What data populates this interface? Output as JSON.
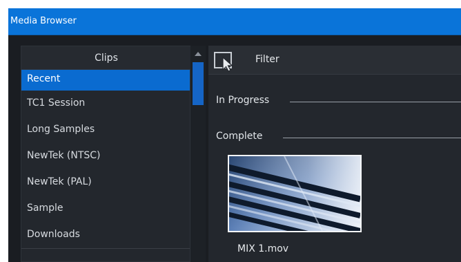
{
  "window": {
    "title": "Media Browser"
  },
  "clips_panel": {
    "header": "Clips",
    "items": [
      {
        "label": "Recent",
        "selected": true
      },
      {
        "label": "TC1 Session",
        "selected": false
      },
      {
        "label": "Long Samples",
        "selected": false
      },
      {
        "label": "NewTek (NTSC)",
        "selected": false
      },
      {
        "label": "NewTek (PAL)",
        "selected": false
      },
      {
        "label": "Sample",
        "selected": false
      },
      {
        "label": "Downloads",
        "selected": false
      }
    ]
  },
  "content_panel": {
    "filter_label": "Filter",
    "sections": {
      "in_progress": "In Progress",
      "complete": "Complete"
    },
    "media_items": [
      {
        "name": "MIX 1.mov",
        "icon": "video-thumbnail"
      }
    ]
  },
  "colors": {
    "title_bar": "#0a74d9",
    "selection": "#0a6bd0",
    "background": "#1a1d22",
    "panel": "#23272d"
  }
}
